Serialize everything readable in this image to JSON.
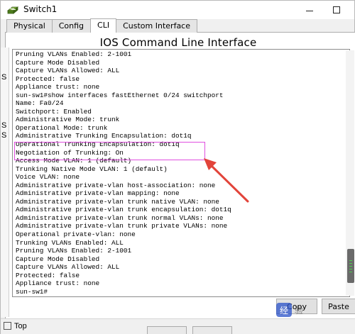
{
  "window": {
    "title": "Switch1"
  },
  "tabs": [
    {
      "label": "Physical",
      "active": false
    },
    {
      "label": "Config",
      "active": false
    },
    {
      "label": "CLI",
      "active": true
    },
    {
      "label": "Custom Interface",
      "active": false
    }
  ],
  "cli": {
    "heading": "IOS Command Line Interface",
    "lines": [
      "Pruning VLANs Enabled: 2-1001",
      "Capture Mode Disabled",
      "Capture VLANs Allowed: ALL",
      "Protected: false",
      "Appliance trust: none",
      "sun-sw1#show interfaces fastEthernet 0/24 switchport",
      "Name: Fa0/24",
      "Switchport: Enabled",
      "Administrative Mode: trunk",
      "Operational Mode: trunk",
      "Administrative Trunking Encapsulation: dot1q",
      "Operational Trunking Encapsulation: dot1q",
      "Negotiation of Trunking: On",
      "Access Mode VLAN: 1 (default)",
      "Trunking Native Mode VLAN: 1 (default)",
      "Voice VLAN: none",
      "Administrative private-vlan host-association: none",
      "Administrative private-vlan mapping: none",
      "Administrative private-vlan trunk native VLAN: none",
      "Administrative private-vlan trunk encapsulation: dot1q",
      "Administrative private-vlan trunk normal VLANs: none",
      "Administrative private-vlan trunk private VLANs: none",
      "Operational private-vlan: none",
      "Trunking VLANs Enabled: ALL",
      "Pruning VLANs Enabled: 2-1001",
      "Capture Mode Disabled",
      "Capture VLANs Allowed: ALL",
      "Protected: false",
      "Appliance trust: none",
      "sun-sw1#"
    ]
  },
  "side_clip": {
    "letters": [
      "S",
      "S",
      "S"
    ]
  },
  "buttons": {
    "copy": "Copy",
    "paste": "Paste"
  },
  "bottom": {
    "top_label": "Top"
  },
  "watermark": {
    "badge": "经",
    "text": "验"
  },
  "colors": {
    "highlight": "#e04fe0",
    "arrow": "#e2443a",
    "window_bg": "#f0f0f0"
  },
  "icons": {
    "app": "switch-icon",
    "minimize": "minimize-icon",
    "maximize": "maximize-icon"
  }
}
